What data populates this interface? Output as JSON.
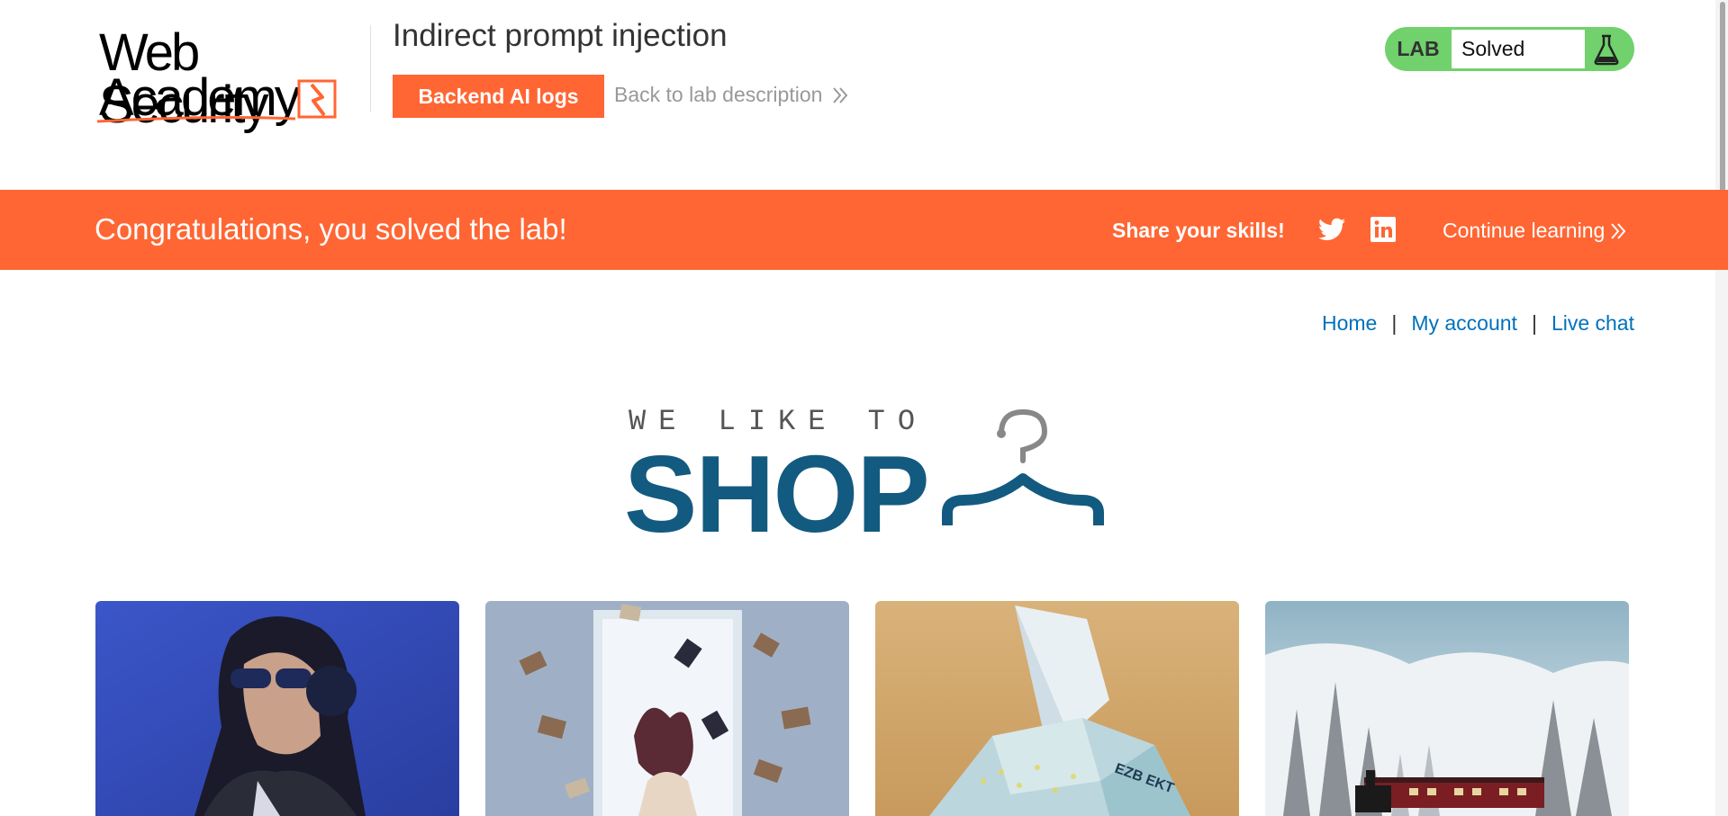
{
  "header": {
    "logo_line1": "Web Security",
    "logo_line2": "Academy",
    "lab_title": "Indirect prompt injection",
    "backend_button": "Backend AI logs",
    "back_link": "Back to lab description",
    "lab_badge": "LAB",
    "lab_status": "Solved"
  },
  "banner": {
    "message": "Congratulations, you solved the lab!",
    "share_label": "Share your skills!",
    "continue_label": "Continue learning"
  },
  "nav": {
    "home": "Home",
    "my_account": "My account",
    "live_chat": "Live chat",
    "separator": "|"
  },
  "shop_logo": {
    "tagline": "WE LIKE TO",
    "word": "SHOP"
  },
  "products": [
    {
      "image": "woman-with-headphones-and-sunglasses"
    },
    {
      "image": "woman-with-flying-books"
    },
    {
      "image": "origami-banknote-sculpture"
    },
    {
      "image": "steam-train-in-snowy-forest"
    }
  ],
  "colors": {
    "accent_orange": "#ff6633",
    "lab_green": "#70d16d",
    "link_blue": "#0071bc",
    "shop_blue": "#135a80"
  },
  "icons": [
    "academy-logo-mark-icon",
    "double-chevron-right-icon",
    "flask-icon",
    "twitter-icon",
    "linkedin-icon",
    "hanger-icon"
  ]
}
